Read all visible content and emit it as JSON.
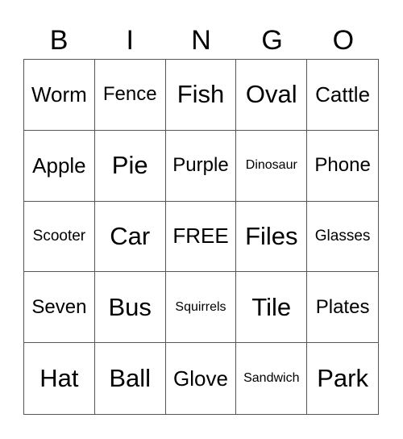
{
  "header": [
    "B",
    "I",
    "N",
    "G",
    "O"
  ],
  "cells": [
    {
      "text": "Worm",
      "size": "s-m"
    },
    {
      "text": "Fence",
      "size": "s-s"
    },
    {
      "text": "Fish",
      "size": "s-l"
    },
    {
      "text": "Oval",
      "size": "s-l"
    },
    {
      "text": "Cattle",
      "size": "s-m"
    },
    {
      "text": "Apple",
      "size": "s-m"
    },
    {
      "text": "Pie",
      "size": "s-l"
    },
    {
      "text": "Purple",
      "size": "s-s"
    },
    {
      "text": "Dinosaur",
      "size": "s-xxs"
    },
    {
      "text": "Phone",
      "size": "s-s"
    },
    {
      "text": "Scooter",
      "size": "s-xs"
    },
    {
      "text": "Car",
      "size": "s-l"
    },
    {
      "text": "FREE",
      "size": "s-m"
    },
    {
      "text": "Files",
      "size": "s-l"
    },
    {
      "text": "Glasses",
      "size": "s-xs"
    },
    {
      "text": "Seven",
      "size": "s-s"
    },
    {
      "text": "Bus",
      "size": "s-l"
    },
    {
      "text": "Squirrels",
      "size": "s-xxs"
    },
    {
      "text": "Tile",
      "size": "s-l"
    },
    {
      "text": "Plates",
      "size": "s-s"
    },
    {
      "text": "Hat",
      "size": "s-l"
    },
    {
      "text": "Ball",
      "size": "s-l"
    },
    {
      "text": "Glove",
      "size": "s-m"
    },
    {
      "text": "Sandwich",
      "size": "s-xxs"
    },
    {
      "text": "Park",
      "size": "s-l"
    }
  ]
}
